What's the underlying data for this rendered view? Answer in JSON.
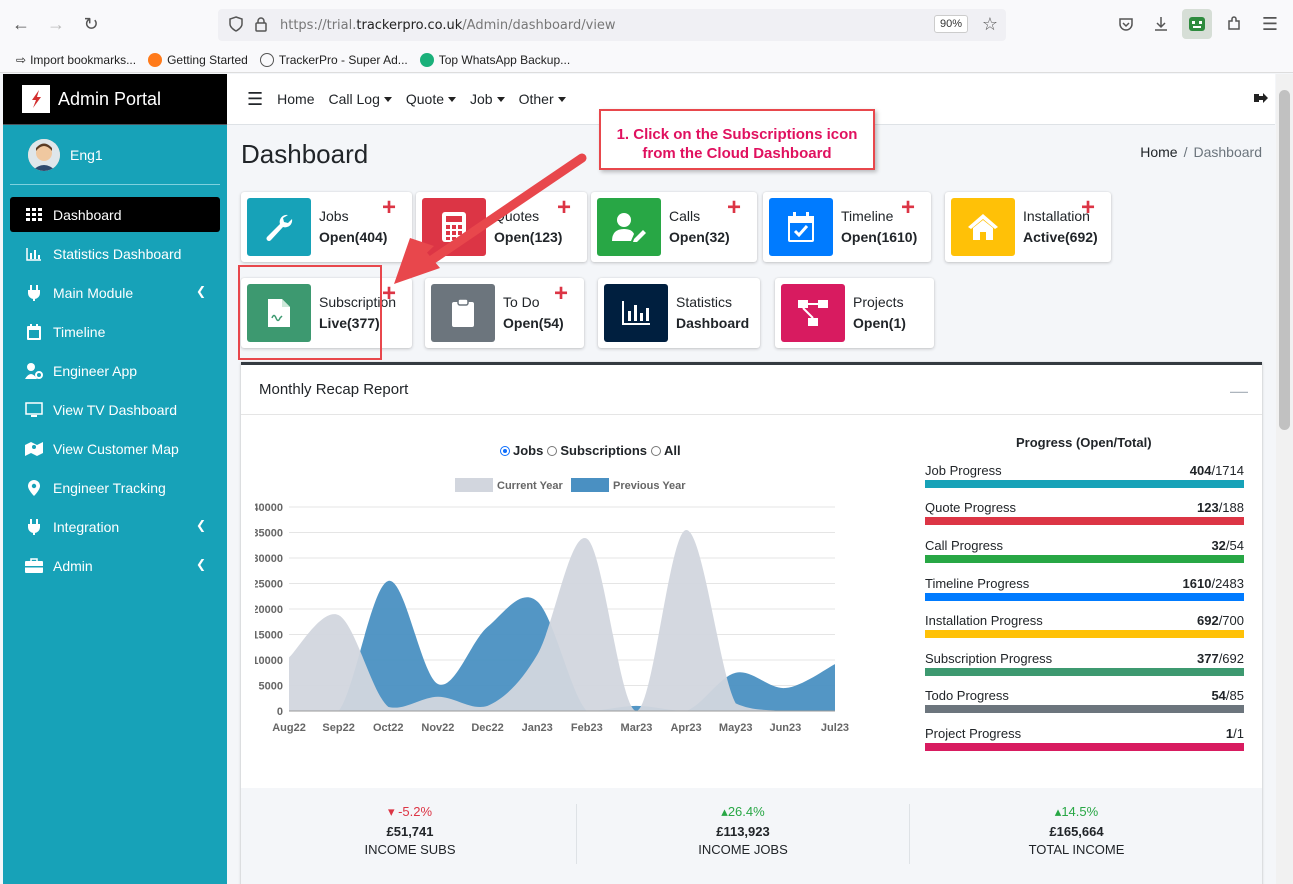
{
  "browser": {
    "url_prefix": "https://trial.",
    "url_domain": "trackerpro.co.uk",
    "url_path": "/Admin/dashboard/view",
    "zoom": "90%",
    "bookmarks": [
      "Import bookmarks...",
      "Getting Started",
      "TrackerPro - Super Ad...",
      "Top WhatsApp Backup..."
    ]
  },
  "sidebar": {
    "brand": "Admin Portal",
    "user": "Eng1",
    "items": [
      {
        "label": "Dashboard"
      },
      {
        "label": "Statistics Dashboard"
      },
      {
        "label": "Main Module"
      },
      {
        "label": "Timeline"
      },
      {
        "label": "Engineer App"
      },
      {
        "label": "View TV Dashboard"
      },
      {
        "label": "View Customer Map"
      },
      {
        "label": "Engineer Tracking"
      },
      {
        "label": "Integration"
      },
      {
        "label": "Admin"
      }
    ]
  },
  "topnav": {
    "home": "Home",
    "call_log": "Call Log",
    "quote": "Quote",
    "job": "Job",
    "other": "Other"
  },
  "page": {
    "title": "Dashboard",
    "breadcrumb_home": "Home",
    "breadcrumb_sep": "/",
    "breadcrumb_current": "Dashboard"
  },
  "tiles": [
    {
      "title": "Jobs",
      "value": "Open(404)",
      "color": "#17a2b8"
    },
    {
      "title": "Quotes",
      "value": "Open(123)",
      "color": "#dc3545"
    },
    {
      "title": "Calls",
      "value": "Open(32)",
      "color": "#28a745"
    },
    {
      "title": "Timeline",
      "value": "Open(1610)",
      "color": "#007bff"
    },
    {
      "title": "Installation",
      "value": "Active(692)",
      "color": "#ffc107"
    },
    {
      "title": "Subscription",
      "value": "Live(377)",
      "color": "#3d9970"
    },
    {
      "title": "To Do",
      "value": "Open(54)",
      "color": "#6c757d"
    },
    {
      "title": "Statistics",
      "value": "Dashboard",
      "color": "#001f3f"
    },
    {
      "title": "Projects",
      "value": "Open(1)",
      "color": "#d81b60"
    }
  ],
  "annotation": {
    "line1": "1. Click on the Subscriptions  icon",
    "line2": "from the Cloud Dashboard"
  },
  "recap": {
    "title": "Monthly Recap Report",
    "radio": [
      "Jobs",
      "Subscriptions",
      "All"
    ],
    "progress_title": "Progress (Open/Total)",
    "progress": [
      {
        "label": "Job Progress",
        "open": "404",
        "total": "/1714",
        "color": "#17a2b8"
      },
      {
        "label": "Quote Progress",
        "open": "123",
        "total": "/188",
        "color": "#dc3545"
      },
      {
        "label": "Call Progress",
        "open": "32",
        "total": "/54",
        "color": "#28a745"
      },
      {
        "label": "Timeline Progress",
        "open": "1610",
        "total": "/2483",
        "color": "#007bff"
      },
      {
        "label": "Installation Progress",
        "open": "692",
        "total": "/700",
        "color": "#ffc107"
      },
      {
        "label": "Subscription Progress",
        "open": "377",
        "total": "/692",
        "color": "#3d9970"
      },
      {
        "label": "Todo Progress",
        "open": "54",
        "total": "/85",
        "color": "#6c757d"
      },
      {
        "label": "Project Progress",
        "open": "1",
        "total": "/1",
        "color": "#d81b60"
      }
    ],
    "stats": [
      {
        "pct": "-5.2%",
        "amount": "£51,741",
        "label": "INCOME SUBS",
        "trend": "down"
      },
      {
        "pct": "26.4%",
        "amount": "£113,923",
        "label": "INCOME JOBS",
        "trend": "up"
      },
      {
        "pct": "14.5%",
        "amount": "£165,664",
        "label": "TOTAL INCOME",
        "trend": "up"
      }
    ]
  },
  "chart_data": {
    "type": "area",
    "x": [
      "Aug22",
      "Sep22",
      "Oct22",
      "Nov22",
      "Dec22",
      "Jan23",
      "Feb23",
      "Mar23",
      "Apr23",
      "May23",
      "Jun23",
      "Jul23"
    ],
    "series": [
      {
        "name": "Current Year",
        "color": "#d2d6de",
        "values": [
          10500,
          18800,
          800,
          2800,
          1000,
          11000,
          33800,
          0,
          35500,
          1500,
          0,
          0
        ]
      },
      {
        "name": "Previous Year",
        "color": "#4a90c2",
        "values": [
          0,
          0,
          25500,
          5300,
          16500,
          21500,
          0,
          1000,
          0,
          7500,
          4500,
          9200
        ]
      }
    ],
    "ylim": [
      0,
      40000
    ],
    "yticks": [
      0,
      5000,
      10000,
      15000,
      20000,
      25000,
      30000,
      35000,
      40000
    ],
    "legend": "top",
    "grid": true
  }
}
